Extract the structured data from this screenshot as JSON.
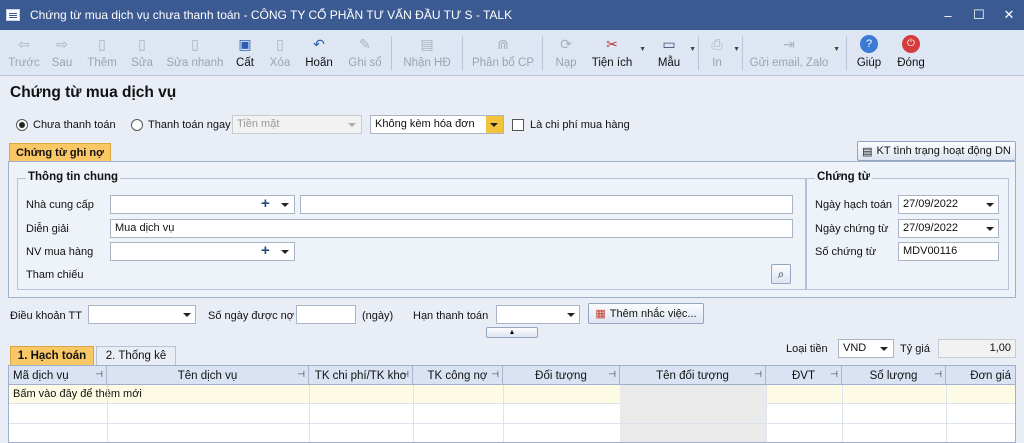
{
  "window": {
    "title": "Chứng từ mua dịch vụ chưa thanh toán - CÔNG TY CỔ PHẦN TƯ VẤN ĐẦU TƯ S - TALK",
    "controls": [
      "–",
      "☐",
      "✕"
    ]
  },
  "toolbar": {
    "back": "Trước",
    "next": "Sau",
    "add": "Thêm",
    "edit": "Sửa",
    "quick_edit": "Sửa nhanh",
    "save": "Cất",
    "delete": "Xóa",
    "undo": "Hoãn",
    "post": "Ghi sổ",
    "receive_invoice": "Nhận HĐ",
    "allocate": "Phân bổ CP",
    "reload": "Nạp",
    "utilities": "Tiện ích",
    "template": "Mẫu",
    "print": "In",
    "send": "Gửi email, Zalo",
    "help": "Giúp",
    "close": "Đóng"
  },
  "heading": "Chứng từ mua dịch vụ",
  "payment": {
    "unpaid_label": "Chưa thanh toán",
    "paid_now_label": "Thanh toán ngay",
    "method_value": "Tiền mặt",
    "invoice_value": "Không kèm hóa đơn",
    "purchase_cost_label": "Là chi phí mua hàng"
  },
  "tabs": {
    "main": "Chứng từ ghi nợ",
    "kt_button": "KT tình trạng hoạt động DN"
  },
  "general": {
    "title": "Thông tin chung",
    "supplier_label": "Nhà cung cấp",
    "description_label": "Diễn giải",
    "description_value": "Mua dịch vụ",
    "buyer_label": "NV mua hàng",
    "reference_label": "Tham chiếu"
  },
  "voucher": {
    "title": "Chứng từ",
    "posting_date_label": "Ngày hạch toán",
    "posting_date": "27/09/2022",
    "voucher_date_label": "Ngày chứng từ",
    "voucher_date": "27/09/2022",
    "voucher_no_label": "Số chứng từ",
    "voucher_no": "MDV00116"
  },
  "terms": {
    "payment_terms_label": "Điều khoản TT",
    "debt_days_label": "Số ngày được nợ",
    "days_unit": "(ngày)",
    "due_date_label": "Hạn thanh toán",
    "reminder_button": "Thêm nhắc việc..."
  },
  "subtabs": {
    "accounting": "1. Hạch toán",
    "statistics": "2. Thống kê"
  },
  "currency": {
    "label": "Loại tiền",
    "value": "VND",
    "rate_label": "Tỷ giá",
    "rate_value": "1,00"
  },
  "grid": {
    "columns": [
      "Mã dịch vụ",
      "Tên dịch vụ",
      "TK chi phí/TK kho",
      "TK công nợ",
      "Đối tượng",
      "Tên đối tượng",
      "ĐVT",
      "Số lượng",
      "Đơn giá"
    ],
    "new_row_hint": "Bấm vào đây để thêm mới"
  }
}
